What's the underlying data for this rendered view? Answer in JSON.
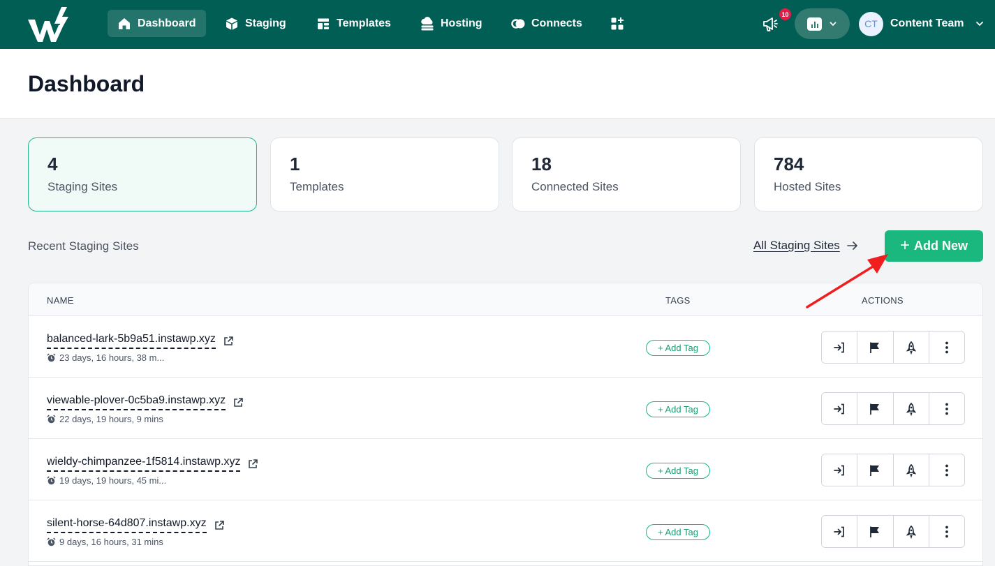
{
  "nav": {
    "items": [
      {
        "label": "Dashboard",
        "icon": "home-icon",
        "active": true
      },
      {
        "label": "Staging",
        "icon": "cube-icon",
        "active": false
      },
      {
        "label": "Templates",
        "icon": "template-icon",
        "active": false
      },
      {
        "label": "Hosting",
        "icon": "cloud-server-icon",
        "active": false
      },
      {
        "label": "Connects",
        "icon": "connect-icon",
        "active": false
      }
    ],
    "apps_icon": "apps-plus-icon",
    "notification_count": "10",
    "user": {
      "initials": "CT",
      "name": "Content Team"
    }
  },
  "header": {
    "title": "Dashboard"
  },
  "stats": [
    {
      "value": "4",
      "label": "Staging Sites"
    },
    {
      "value": "1",
      "label": "Templates"
    },
    {
      "value": "18",
      "label": "Connected Sites"
    },
    {
      "value": "784",
      "label": "Hosted Sites"
    }
  ],
  "recent": {
    "title": "Recent Staging Sites",
    "all_link": "All Staging Sites",
    "add_button": "Add New"
  },
  "table": {
    "headers": {
      "name": "NAME",
      "tags": "TAGS",
      "actions": "ACTIONS"
    },
    "rows": [
      {
        "name": "balanced-lark-5b9a51.instawp.xyz",
        "time": "23 days, 16 hours, 38 m...",
        "tag": "+ Add Tag"
      },
      {
        "name": "viewable-plover-0c5ba9.instawp.xyz",
        "time": "22 days, 19 hours, 9 mins",
        "tag": "+ Add Tag"
      },
      {
        "name": "wieldy-chimpanzee-1f5814.instawp.xyz",
        "time": "19 days, 19 hours, 45 mi...",
        "tag": "+ Add Tag"
      },
      {
        "name": "silent-horse-64d807.instawp.xyz",
        "time": "9 days, 16 hours, 31 mins",
        "tag": "+ Add Tag"
      }
    ]
  },
  "colors": {
    "nav_bg": "#005e54",
    "accent": "#1ab77e",
    "annotation": "#f01e1e"
  }
}
